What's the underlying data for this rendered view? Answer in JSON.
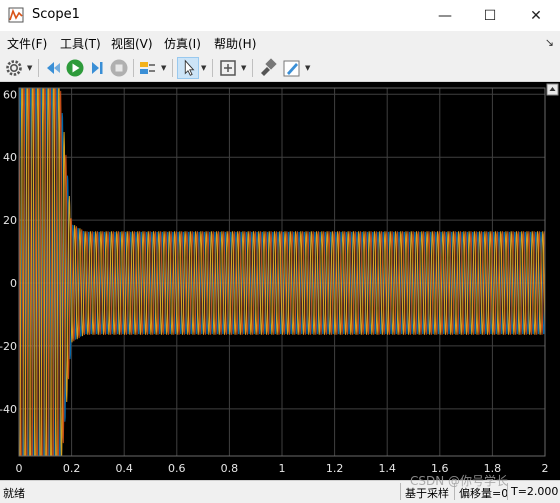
{
  "window": {
    "title": "Scope1",
    "minimize": "—",
    "maximize": "☐",
    "close": "✕"
  },
  "menu": [
    "文件(F)",
    "工具(T)",
    "视图(V)",
    "仿真(I)",
    "帮助(H)"
  ],
  "menu_pin": "↘",
  "toolbar": {
    "items": [
      "gear-icon",
      "step-back-icon",
      "run-icon",
      "step-forward-icon",
      "stop-icon",
      "highlight-icon",
      "cursor-icon",
      "zoom-fit-icon",
      "style-icon",
      "edit-icon"
    ]
  },
  "status": {
    "left": "就绪",
    "mode": "基于采样",
    "offset": "偏移量=0",
    "time": "T=2.000"
  },
  "watermark": "CSDN @你号学长",
  "colors": {
    "plot_bg": "#000000",
    "grid": "#404040",
    "series1": "#0072bd",
    "series2": "#d95319",
    "series3": "#edb120"
  },
  "chart_data": {
    "type": "line",
    "title": "",
    "xlabel": "",
    "ylabel": "",
    "xlim": [
      0,
      2
    ],
    "ylim": [
      -55,
      62
    ],
    "xticks": [
      "0",
      "0.2",
      "0.4",
      "0.6",
      "0.8",
      "1",
      "1.2",
      "1.4",
      "1.6",
      "1.8",
      "2"
    ],
    "xtick_values": [
      0,
      0.2,
      0.4,
      0.6,
      0.8,
      1,
      1.2,
      1.4,
      1.6,
      1.8,
      2
    ],
    "yticks": [
      "-40",
      "-20",
      "0",
      "20",
      "40",
      "60"
    ],
    "ytick_values": [
      -40,
      -20,
      0,
      20,
      40,
      60
    ],
    "grid": true,
    "series": [
      {
        "color": "#0072bd",
        "phase_deg": 0,
        "freq_hz": 50,
        "envelope": [
          [
            0,
            70
          ],
          [
            0.15,
            70
          ],
          [
            0.2,
            19
          ],
          [
            0.25,
            16.5
          ],
          [
            2,
            16.5
          ]
        ]
      },
      {
        "color": "#d95319",
        "phase_deg": 120,
        "freq_hz": 50,
        "envelope": [
          [
            0,
            70
          ],
          [
            0.15,
            70
          ],
          [
            0.2,
            19
          ],
          [
            0.25,
            16.5
          ],
          [
            2,
            16.5
          ]
        ]
      },
      {
        "color": "#edb120",
        "phase_deg": 240,
        "freq_hz": 50,
        "envelope": [
          [
            0,
            70
          ],
          [
            0.15,
            70
          ],
          [
            0.2,
            19
          ],
          [
            0.25,
            16.5
          ],
          [
            2,
            16.5
          ]
        ]
      }
    ]
  }
}
